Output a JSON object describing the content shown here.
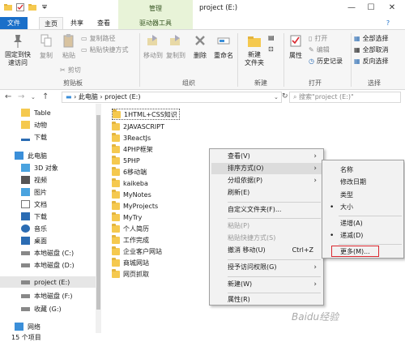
{
  "window": {
    "contextual_group": "管理",
    "title": "project (E:)",
    "buttons": [
      "—",
      "☐",
      "✕"
    ],
    "help_glyph": "?"
  },
  "ribbon_tabs": [
    "文件",
    "主页",
    "共享",
    "查看",
    "驱动器工具"
  ],
  "ribbon": {
    "clipboard": {
      "pin": "固定到快\n速访问",
      "copy": "复制",
      "paste": "粘贴",
      "copy_path": "复制路径",
      "paste_shortcut": "粘贴快捷方式",
      "cut": "剪切",
      "label": "剪贴板"
    },
    "organize": {
      "move_to": "移动到",
      "copy_to": "复制到",
      "delete": "删除",
      "rename": "重命名",
      "label": "组织"
    },
    "new": {
      "new_folder": "新建\n文件夹",
      "label": "新建"
    },
    "open": {
      "properties": "属性",
      "open": "打开",
      "edit": "编辑",
      "history": "历史记录",
      "label": "打开"
    },
    "select": {
      "select_all": "全部选择",
      "select_none": "全部取消",
      "invert": "反向选择",
      "label": "选择"
    }
  },
  "address": {
    "path_root": "此电脑",
    "path_leaf": "project (E:)",
    "search_placeholder": "搜索\"project (E:)\""
  },
  "nav_pane": [
    {
      "label": "Table",
      "icon": "folder-icon",
      "color": "#f5c94f"
    },
    {
      "label": "动物",
      "icon": "folder-icon",
      "color": "#f5c94f"
    },
    {
      "label": "下载",
      "icon": "download-icon",
      "color": "#2b6cb3"
    },
    {
      "label": "此电脑",
      "icon": "computer-icon",
      "color": "#3b8fd9"
    },
    {
      "label": "3D 对象",
      "icon": "3d-objects-icon",
      "color": "#4aa3df"
    },
    {
      "label": "视频",
      "icon": "video-icon",
      "color": "#555"
    },
    {
      "label": "图片",
      "icon": "picture-icon",
      "color": "#4aa3df"
    },
    {
      "label": "文档",
      "icon": "document-icon",
      "color": "#777"
    },
    {
      "label": "下载",
      "icon": "download-icon",
      "color": "#2b6cb3"
    },
    {
      "label": "音乐",
      "icon": "music-icon",
      "color": "#2b6cb3"
    },
    {
      "label": "桌面",
      "icon": "desktop-icon",
      "color": "#2b6cb3"
    },
    {
      "label": "本地磁盘 (C:)",
      "icon": "drive-icon",
      "color": "#666"
    },
    {
      "label": "本地磁盘 (D:)",
      "icon": "drive-icon",
      "color": "#666"
    },
    {
      "label": "project (E:)",
      "icon": "drive-icon",
      "color": "#666"
    },
    {
      "label": "本地磁盘 (F:)",
      "icon": "drive-icon",
      "color": "#666"
    },
    {
      "label": "收藏 (G:)",
      "icon": "drive-icon",
      "color": "#666"
    },
    {
      "label": "网络",
      "icon": "network-icon",
      "color": "#3b8fd9"
    }
  ],
  "files": [
    "1HTML+CSS知识",
    "2JAVASCRIPT",
    "3ReactJs",
    "4PHP框架",
    "5PHP",
    "6移动端",
    "kaikeba",
    "MyNotes",
    "MyProjects",
    "MyTry",
    "个人简历",
    "工作完成",
    "企业客户网站",
    "商城网站",
    "网页抓取"
  ],
  "status": "15 个项目",
  "context_menu": {
    "view": "查看(V)",
    "sort": "排序方式(O)",
    "group": "分组依据(P)",
    "refresh": "刷新(E)",
    "customize": "自定义文件夹(F)...",
    "paste": "粘贴(P)",
    "paste_shortcut": "粘贴快捷方式(S)",
    "undo": "撤消 移动(U)",
    "undo_shortcut": "Ctrl+Z",
    "grant": "授予访问权限(G)",
    "new": "新建(W)",
    "properties": "属性(R)",
    "arrow": "›"
  },
  "sort_submenu": {
    "name": "名称",
    "date": "修改日期",
    "type": "类型",
    "size": "大小",
    "asc": "递增(A)",
    "desc": "递减(D)",
    "more": "更多(M)...",
    "bullet": "•"
  },
  "watermark": "Baidu经验"
}
